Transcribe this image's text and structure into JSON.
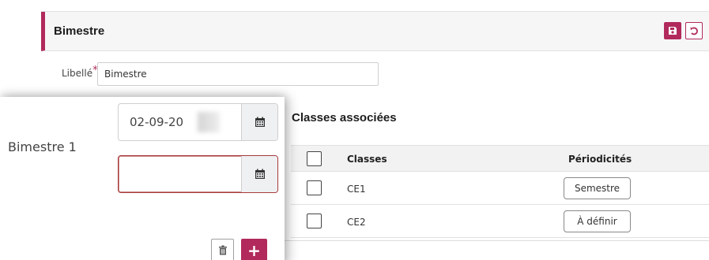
{
  "panel": {
    "title": "Bimestre",
    "accent_color": "#b12a5b",
    "save_icon": "floppy-disk-icon",
    "undo_icon": "undo-icon"
  },
  "libelle": {
    "label": "Libellé",
    "required_mark": "*",
    "value": "Bimestre"
  },
  "classes": {
    "title": "Classes associées",
    "headers": {
      "classes": "Classes",
      "periodicites": "Périodicités"
    },
    "rows": [
      {
        "classe": "CE1",
        "periodicite": "Semestre",
        "checked": false
      },
      {
        "classe": "CE2",
        "periodicite": "À définir",
        "checked": false
      }
    ]
  },
  "period_card": {
    "label": "Bimestre 1",
    "start_date": "02-09-20",
    "end_date": "",
    "calendar_icon": "calendar-icon",
    "delete_icon": "trash-icon",
    "add_label": "+"
  }
}
